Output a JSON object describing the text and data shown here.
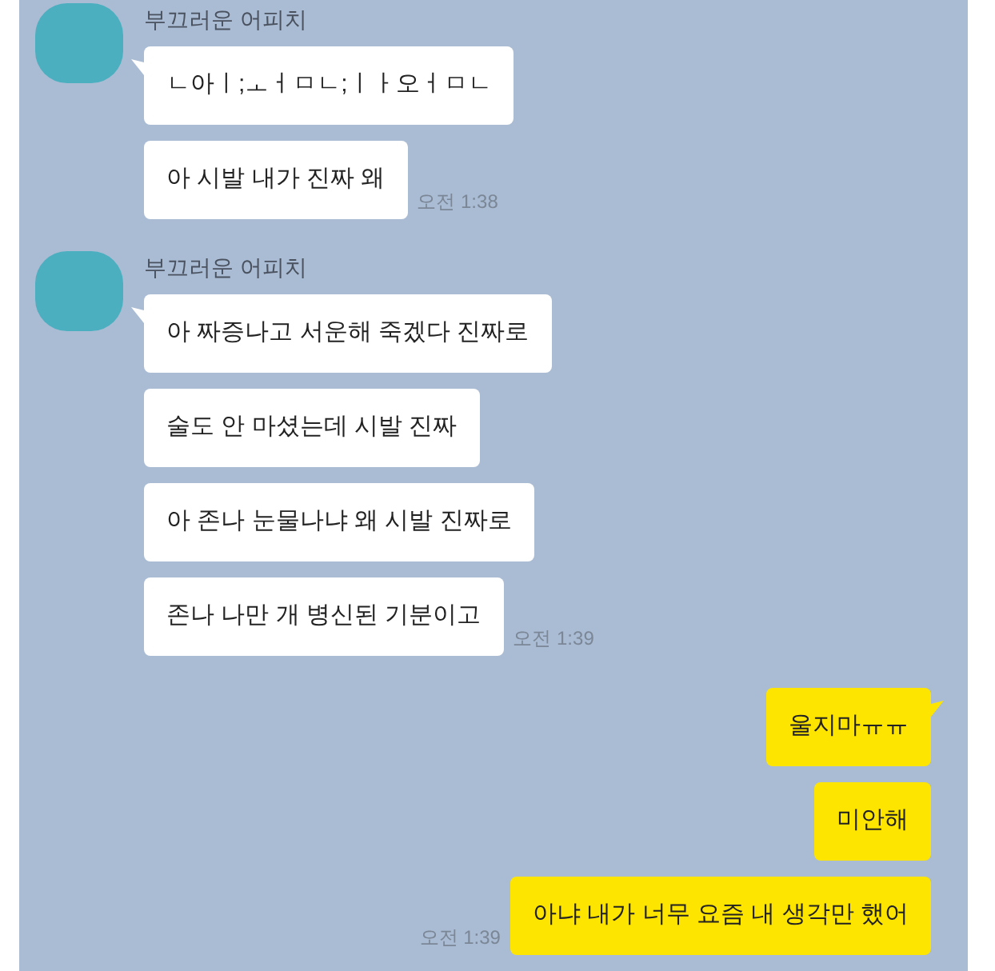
{
  "groups": [
    {
      "kind": "received",
      "sender": "부끄러운 어피치",
      "messages": [
        {
          "text": "ㄴ아ㅣ;ㅗㅓㅁㄴ;ㅣㅏ오ㅓㅁㄴ"
        },
        {
          "text": "아 시발 내가 진짜 왜",
          "time": "오전 1:38"
        }
      ]
    },
    {
      "kind": "received",
      "sender": "부끄러운 어피치",
      "messages": [
        {
          "text": "아 짜증나고 서운해 죽겠다 진짜로"
        },
        {
          "text": "술도 안 마셨는데 시발 진짜"
        },
        {
          "text": "아 존나 눈물나냐 왜 시발 진짜로"
        },
        {
          "text": "존나 나만 개 병신된 기분이고",
          "time": "오전 1:39"
        }
      ]
    },
    {
      "kind": "sent",
      "messages": [
        {
          "text": "울지마ㅠㅠ"
        },
        {
          "text": "미안해"
        },
        {
          "text": "아냐 내가 너무 요즘 내 생각만 했어",
          "time": "오전 1:39"
        }
      ]
    }
  ]
}
